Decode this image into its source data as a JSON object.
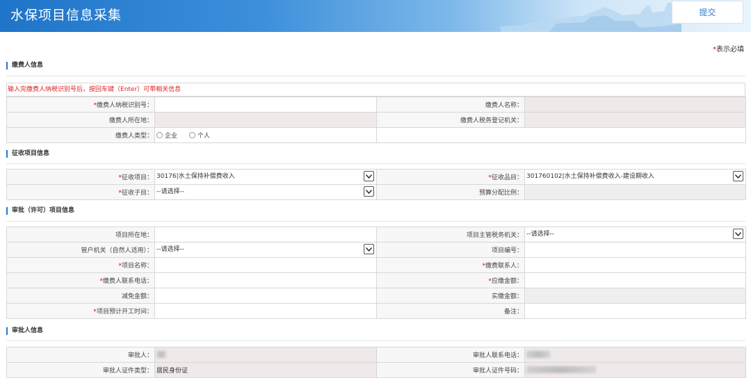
{
  "header": {
    "title": "水保项目信息采集",
    "submit_label": "提交"
  },
  "required_note": {
    "star": "*",
    "text": "表示必填"
  },
  "sections": {
    "payer": "缴费人信息",
    "collection": "征收项目信息",
    "approval_project": "审批（许可）项目信息",
    "approver": "审批人信息"
  },
  "notice": "输入完缴费人纳税识别号后，按回车键（Enter）可带相关信息",
  "payer": {
    "tax_id_label": "缴费人纳税识别号：",
    "name_label": "缴费人名称：",
    "location_label": "缴费人所在地：",
    "tax_office_label": "缴费人税务登记机关：",
    "type_label": "缴费人类型：",
    "type_options": [
      "企业",
      "个人"
    ]
  },
  "collection": {
    "item_label": "征收项目：",
    "item_value": "30176|水土保持补偿费收入",
    "category_label": "征收品目：",
    "category_value": "301760102|水土保持补偿费收入-建设期收入",
    "subitem_label": "征收子目：",
    "subitem_value": "--请选择--",
    "ratio_label": "预算分配比例："
  },
  "project": {
    "location_label": "项目所在地：",
    "authority_label": "项目主管税务机关：",
    "authority_value": "--请选择--",
    "account_office_label": "管户机关（自然人适用）：",
    "account_office_value": "--请选择--",
    "number_label": "项目编号：",
    "name_label": "项目名称：",
    "contact_label": "缴费联系人：",
    "phone_label": "缴费人联系电话：",
    "amount_due_label": "应缴金额：",
    "reduction_label": "减免金额：",
    "actual_label": "实缴金额：",
    "start_time_label": "项目预计开工时间：",
    "remark_label": "备注："
  },
  "approver": {
    "name_label": "审批人：",
    "phone_label": "审批人联系电话：",
    "id_type_label": "审批人证件类型：",
    "id_type_value": "居民身份证",
    "id_number_label": "审批人证件号码："
  },
  "colors": {
    "header_blue": "#1e74c8",
    "required_red": "#d00000",
    "notice_red": "#e02020",
    "accent": "#1f77d0"
  },
  "icons": [
    "chevron-down-icon",
    "radio-icon"
  ]
}
